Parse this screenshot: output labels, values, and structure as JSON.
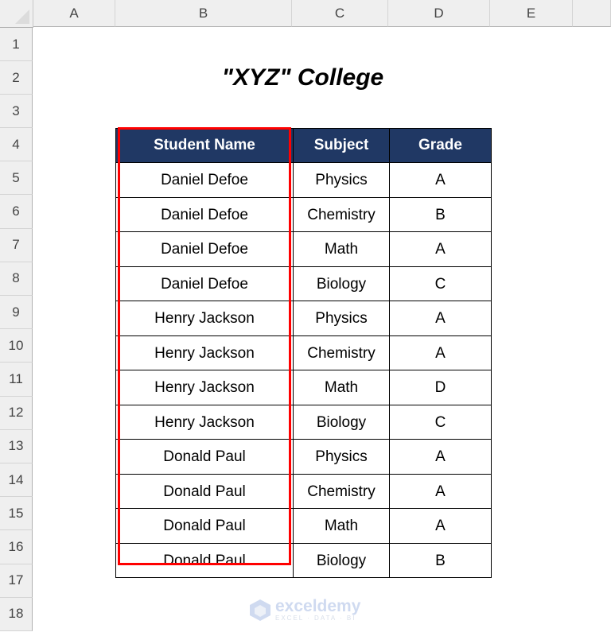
{
  "sheet": {
    "columns": [
      "A",
      "B",
      "C",
      "D",
      "E"
    ],
    "rows": [
      "1",
      "2",
      "3",
      "4",
      "5",
      "6",
      "7",
      "8",
      "9",
      "10",
      "11",
      "12",
      "13",
      "14",
      "15",
      "16",
      "17",
      "18"
    ]
  },
  "title": "\"XYZ\" College",
  "table": {
    "headers": [
      "Student Name",
      "Subject",
      "Grade"
    ],
    "header_bg": "#203864",
    "rows": [
      [
        "Daniel Defoe",
        "Physics",
        "A"
      ],
      [
        "Daniel Defoe",
        "Chemistry",
        "B"
      ],
      [
        "Daniel Defoe",
        "Math",
        "A"
      ],
      [
        "Daniel Defoe",
        "Biology",
        "C"
      ],
      [
        "Henry Jackson",
        "Physics",
        "A"
      ],
      [
        "Henry Jackson",
        "Chemistry",
        "A"
      ],
      [
        "Henry Jackson",
        "Math",
        "D"
      ],
      [
        "Henry Jackson",
        "Biology",
        "C"
      ],
      [
        "Donald Paul",
        "Physics",
        "A"
      ],
      [
        "Donald Paul",
        "Chemistry",
        "A"
      ],
      [
        "Donald Paul",
        "Math",
        "A"
      ],
      [
        "Donald Paul",
        "Biology",
        "B"
      ]
    ]
  },
  "highlight": {
    "column": "Student Name",
    "color": "#ff0000"
  },
  "watermark": {
    "brand": "exceldemy",
    "tagline": "EXCEL · DATA · BI",
    "icon": "exceldemy-logo-icon"
  }
}
